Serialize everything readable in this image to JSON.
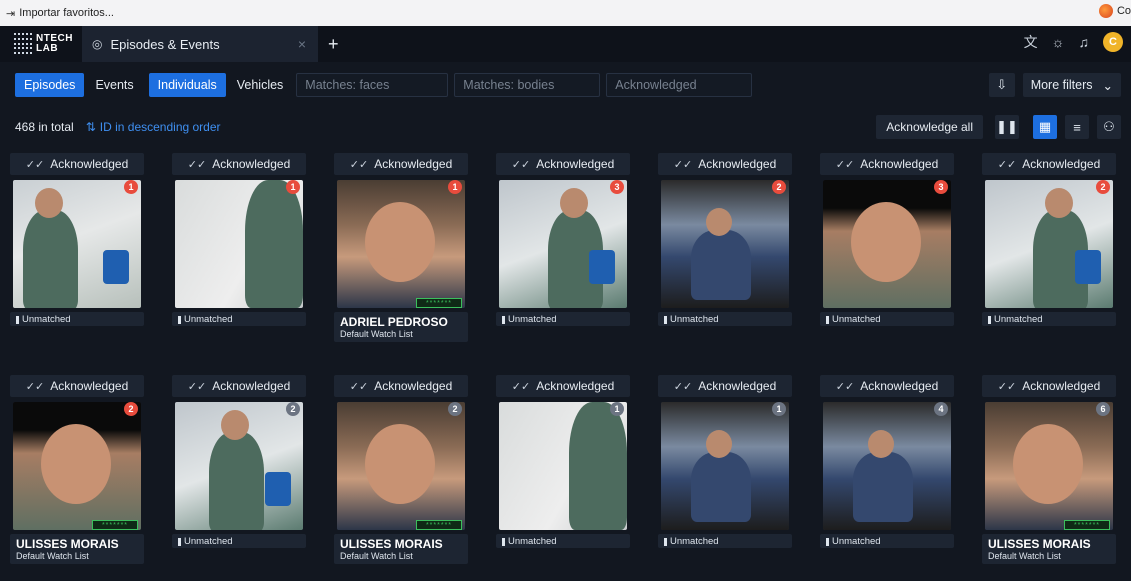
{
  "browser": {
    "bookmark_label": "Importar favoritos...",
    "profile_label": "Co"
  },
  "app": {
    "logo_line1": "NTECH",
    "logo_line2": "LAB",
    "tab_title": "Episodes & Events",
    "avatar_letter": "C"
  },
  "filters": {
    "episodes": "Episodes",
    "events": "Events",
    "individuals": "Individuals",
    "vehicles": "Vehicles",
    "matches_faces": "Matches: faces",
    "matches_bodies": "Matches: bodies",
    "acknowledged": "Acknowledged",
    "more_filters": "More filters"
  },
  "summary": {
    "total": "468 in total",
    "sort": "ID in descending order",
    "acknowledge_all": "Acknowledge all"
  },
  "cards": [
    {
      "ack": "Acknowledged",
      "count": "1",
      "badge": "red",
      "scene": "s-office",
      "status": "Unmatched",
      "name": "",
      "list": "",
      "conf": ""
    },
    {
      "ack": "Acknowledged",
      "count": "1",
      "badge": "red",
      "scene": "s-wall",
      "status": "Unmatched",
      "name": "",
      "list": "",
      "conf": ""
    },
    {
      "ack": "Acknowledged",
      "count": "1",
      "badge": "red",
      "scene": "s-face",
      "status": "",
      "name": "ADRIEL PEDROSO",
      "list": "Default Watch List",
      "conf": "*******"
    },
    {
      "ack": "Acknowledged",
      "count": "3",
      "badge": "red",
      "scene": "s-room",
      "status": "Unmatched",
      "name": "",
      "list": "",
      "conf": ""
    },
    {
      "ack": "Acknowledged",
      "count": "2",
      "badge": "red",
      "scene": "s-desk",
      "status": "Unmatched",
      "name": "",
      "list": "",
      "conf": ""
    },
    {
      "ack": "Acknowledged",
      "count": "3",
      "badge": "red",
      "scene": "s-dark",
      "status": "Unmatched",
      "name": "",
      "list": "",
      "conf": ""
    },
    {
      "ack": "Acknowledged",
      "count": "2",
      "badge": "red",
      "scene": "s-room",
      "status": "Unmatched",
      "name": "",
      "list": "",
      "conf": ""
    },
    {
      "ack": "Acknowledged",
      "count": "2",
      "badge": "red",
      "scene": "s-dark",
      "status": "",
      "name": "ULISSES MORAIS",
      "list": "Default Watch List",
      "conf": "*******"
    },
    {
      "ack": "Acknowledged",
      "count": "2",
      "badge": "gray",
      "scene": "s-room",
      "status": "Unmatched",
      "name": "",
      "list": "",
      "conf": ""
    },
    {
      "ack": "Acknowledged",
      "count": "2",
      "badge": "gray",
      "scene": "s-face",
      "status": "",
      "name": "ULISSES MORAIS",
      "list": "Default Watch List",
      "conf": "*******"
    },
    {
      "ack": "Acknowledged",
      "count": "1",
      "badge": "gray",
      "scene": "s-wall",
      "status": "Unmatched",
      "name": "",
      "list": "",
      "conf": ""
    },
    {
      "ack": "Acknowledged",
      "count": "1",
      "badge": "gray",
      "scene": "s-desk",
      "status": "Unmatched",
      "name": "",
      "list": "",
      "conf": ""
    },
    {
      "ack": "Acknowledged",
      "count": "4",
      "badge": "gray",
      "scene": "s-desk",
      "status": "Unmatched",
      "name": "",
      "list": "",
      "conf": ""
    },
    {
      "ack": "Acknowledged",
      "count": "6",
      "badge": "gray",
      "scene": "s-face",
      "status": "",
      "name": "ULISSES MORAIS",
      "list": "Default Watch List",
      "conf": "*******"
    }
  ],
  "colors": {
    "accent": "#1d6fe0",
    "badge_red": "#e84c3d",
    "badge_gray": "#6c7482",
    "confidence_green": "#3bbf5c"
  },
  "icons": {
    "import": "import-icon",
    "camera": "camera-icon",
    "translate": "translate-icon",
    "theme": "sun-icon",
    "notifications": "bell-icon",
    "export": "export-icon",
    "pause": "pause-icon",
    "grid_view": "grid-icon",
    "list_view": "list-icon",
    "cluster_view": "cluster-icon",
    "sort": "sort-icon",
    "check": "double-check-icon"
  }
}
